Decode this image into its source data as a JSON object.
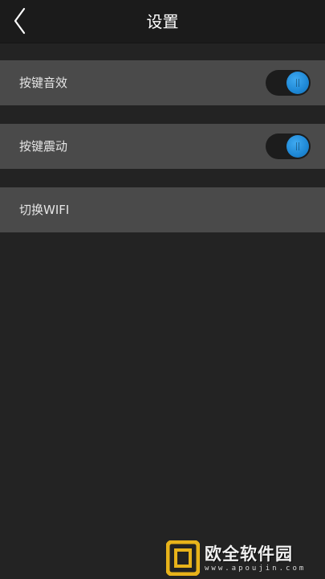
{
  "header": {
    "title": "设置",
    "back_icon": "chevron-left-icon"
  },
  "settings": {
    "key_sound": {
      "label": "按键音效",
      "toggle_on": true
    },
    "key_vibration": {
      "label": "按键震动",
      "toggle_on": true
    },
    "switch_wifi": {
      "label": "切换WIFI"
    }
  },
  "watermark": {
    "title": "欧全软件园",
    "url": "www.apoujin.com"
  },
  "colors": {
    "header_bg": "#1b1b1b",
    "page_bg": "#232323",
    "row_bg": "#4a4a4a",
    "accent": "#1e88d6",
    "logo": "#e8b31a"
  }
}
